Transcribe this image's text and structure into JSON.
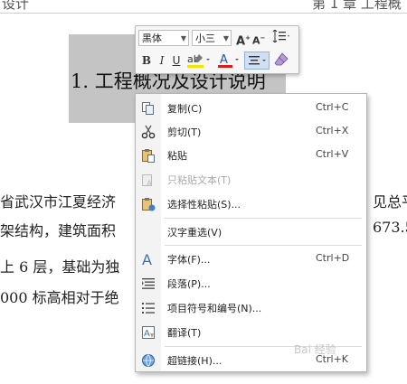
{
  "document": {
    "header_left": "设计",
    "header_right": "第 1 章  工程概",
    "heading": "1. 工程概况及设计说明",
    "body_lines": [
      {
        "left": "省武汉市江夏经济",
        "right": "见总平"
      },
      {
        "left": "架结构，建筑面积",
        "right": "673.5"
      },
      {
        "left": "上 6 层，基础为独",
        "right": ""
      },
      {
        "left": "000 标高相对于绝",
        "right": ""
      }
    ]
  },
  "mini_toolbar": {
    "font_name": "黑体",
    "font_size": "小三",
    "grow_font": "A",
    "shrink_font": "A",
    "bold": "B",
    "italic": "I",
    "underline": "U",
    "font_color_letter": "A",
    "colors": {
      "highlight": "#f2e600",
      "font_color": "#d81e1e",
      "align_active": "#cfe0f5"
    }
  },
  "context_menu": {
    "items": [
      {
        "label": "复制(C)",
        "shortcut": "Ctrl+C",
        "icon": "copy-icon",
        "enabled": true
      },
      {
        "label": "剪切(T)",
        "shortcut": "Ctrl+X",
        "icon": "scissors-icon",
        "enabled": true
      },
      {
        "label": "粘贴",
        "shortcut": "Ctrl+V",
        "icon": "paste-icon",
        "enabled": true
      },
      {
        "label": "只粘贴文本(T)",
        "shortcut": "",
        "icon": "paste-text-icon",
        "enabled": false
      },
      {
        "label": "选择性粘贴(S)...",
        "shortcut": "",
        "icon": "paste-special-icon",
        "enabled": true
      },
      {
        "label": "汉字重选(V)",
        "shortcut": "",
        "icon": "",
        "enabled": true
      },
      {
        "label": "字体(F)...",
        "shortcut": "Ctrl+D",
        "icon": "font-icon",
        "enabled": true
      },
      {
        "label": "段落(P)...",
        "shortcut": "",
        "icon": "paragraph-icon",
        "enabled": true
      },
      {
        "label": "项目符号和编号(N)...",
        "shortcut": "",
        "icon": "bullets-icon",
        "enabled": true
      },
      {
        "label": "翻译(T)",
        "shortcut": "",
        "icon": "translate-icon",
        "enabled": true
      },
      {
        "label": "超链接(H)...",
        "shortcut": "Ctrl+K",
        "icon": "hyperlink-icon",
        "enabled": true
      }
    ]
  },
  "watermark": "Bai 经验"
}
